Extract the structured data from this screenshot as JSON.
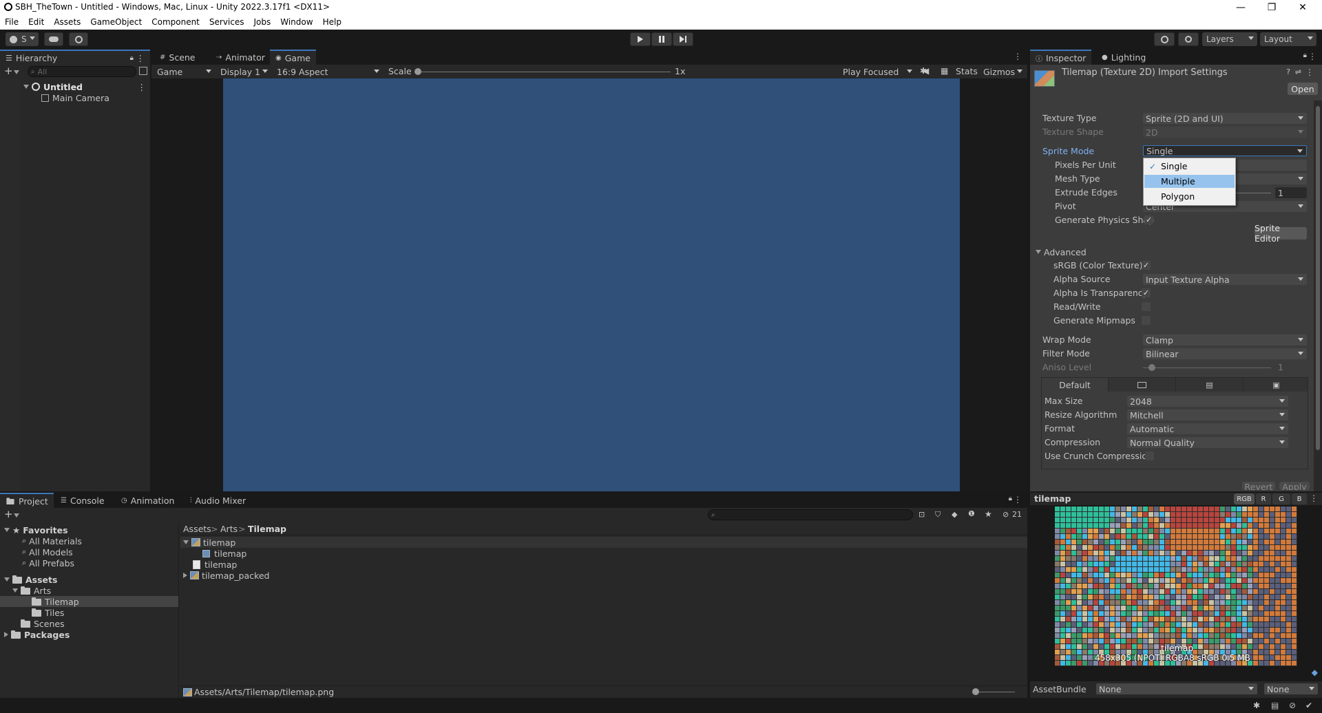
{
  "window": {
    "title": "SBH_TheTown - Untitled - Windows, Mac, Linux - Unity 2022.3.17f1 <DX11>",
    "minimize": "—",
    "maximize": "❐",
    "close": "✕"
  },
  "menu": [
    "File",
    "Edit",
    "Assets",
    "GameObject",
    "Component",
    "Services",
    "Jobs",
    "Window",
    "Help"
  ],
  "toolbar": {
    "account": "S",
    "layers": "Layers",
    "layout": "Layout"
  },
  "hierarchy": {
    "tab": "Hierarchy",
    "search_placeholder": "All",
    "scene": "Untitled",
    "items": [
      "Main Camera"
    ]
  },
  "scene_view": {
    "tabs": [
      "Scene",
      "Animator",
      "Game"
    ],
    "game_dropdown": "Game",
    "display": "Display 1",
    "aspect": "16:9 Aspect",
    "scale_label": "Scale",
    "scale_value": "1x",
    "play_mode": "Play Focused",
    "stats": "Stats",
    "gizmos": "Gizmos",
    "background": "#30507a"
  },
  "inspector": {
    "tabs": [
      "Inspector",
      "Lighting"
    ],
    "title": "Tilemap (Texture 2D) Import Settings",
    "open_button": "Open",
    "texture_type_label": "Texture Type",
    "texture_type": "Sprite (2D and UI)",
    "texture_shape_label": "Texture Shape",
    "texture_shape": "2D",
    "sprite_mode_label": "Sprite Mode",
    "sprite_mode": "Single",
    "pixels_per_unit_label": "Pixels Per Unit",
    "mesh_type_label": "Mesh Type",
    "extrude_edges_label": "Extrude Edges",
    "extrude_edges": "1",
    "pivot_label": "Pivot",
    "pivot": "Center",
    "gen_physics_label": "Generate Physics Shap",
    "sprite_editor_button": "Sprite Editor",
    "advanced_label": "Advanced",
    "srgb_label": "sRGB (Color Texture)",
    "alpha_source_label": "Alpha Source",
    "alpha_source": "Input Texture Alpha",
    "alpha_transparency_label": "Alpha Is Transparency",
    "read_write_label": "Read/Write",
    "gen_mipmaps_label": "Generate Mipmaps",
    "wrap_mode_label": "Wrap Mode",
    "wrap_mode": "Clamp",
    "filter_mode_label": "Filter Mode",
    "filter_mode": "Bilinear",
    "aniso_label": "Aniso Level",
    "aniso": "1",
    "platform_default": "Default",
    "max_size_label": "Max Size",
    "max_size": "2048",
    "resize_label": "Resize Algorithm",
    "resize": "Mitchell",
    "format_label": "Format",
    "format": "Automatic",
    "compression_label": "Compression",
    "compression": "Normal Quality",
    "crunch_label": "Use Crunch Compression",
    "revert_button": "Revert",
    "apply_button": "Apply",
    "dropdown_options": [
      "Single",
      "Multiple",
      "Polygon"
    ],
    "dropdown_checked": "Single",
    "dropdown_highlight": "Multiple"
  },
  "preview": {
    "name": "tilemap",
    "channels": [
      "RGB",
      "R",
      "G",
      "B"
    ],
    "caption_name": "tilemap",
    "caption_info": "458x305 (NPOT)  RGBA8 sRGB  0.5 MB"
  },
  "assetbundle": {
    "label": "AssetBundle",
    "name": "None",
    "variant": "None"
  },
  "project": {
    "tabs": [
      "Project",
      "Console",
      "Animation",
      "Audio Mixer"
    ],
    "hidden_count": "21",
    "favorites_label": "Favorites",
    "favorites": [
      "All Materials",
      "All Models",
      "All Prefabs"
    ],
    "assets_label": "Assets",
    "arts": "Arts",
    "arts_children": [
      "Tilemap",
      "Tiles"
    ],
    "scenes": "Scenes",
    "packages": "Packages",
    "breadcrumb": [
      "Assets",
      "Arts",
      "Tilemap"
    ],
    "files": [
      {
        "name": "tilemap",
        "indent": 0,
        "type": "image",
        "expanded": true
      },
      {
        "name": "tilemap",
        "indent": 1,
        "type": "sprite"
      },
      {
        "name": "tilemap",
        "indent": 0,
        "type": "file"
      },
      {
        "name": "tilemap_packed",
        "indent": 0,
        "type": "image",
        "collapsed": true
      }
    ],
    "status_path": "Assets/Arts/Tilemap/tilemap.png"
  }
}
